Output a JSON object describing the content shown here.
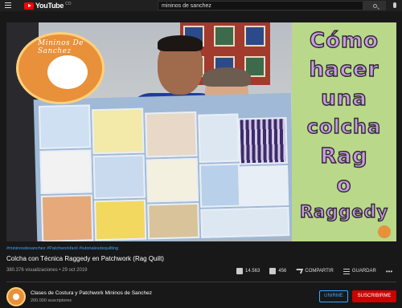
{
  "header": {
    "logo_text": "YouTube",
    "logo_country": "CO",
    "search_value": "mininos de sanchez"
  },
  "video": {
    "logo_text": "Mininos De Sanchez",
    "title_words": [
      "Cómo",
      "hacer",
      "una",
      "colcha",
      "Rag",
      "o",
      "Raggedy"
    ]
  },
  "hashtags": "#mininosdesanchez #Patchworkfacil #tutorialesdequilting",
  "title": "Colcha con Técnica Raggedy en Patchwork (Rag Quilt)",
  "views": "380.376 visualizaciones • 29 oct 2019",
  "actions": {
    "likes": "14.563",
    "dislikes": "456",
    "share": "COMPARTIR",
    "save": "GUARDAR",
    "more": "•••"
  },
  "channel": {
    "name": "Clases de Costura y Patchwork Mininos de Sanchez",
    "subscribers": "200.000 suscriptores",
    "join_label": "UNIRME",
    "subscribe_label": "SUSCRIBIRME"
  },
  "colors": {
    "brand_red": "#ff0000",
    "subscribe_red": "#cc0000",
    "link_blue": "#3ea6ff"
  }
}
